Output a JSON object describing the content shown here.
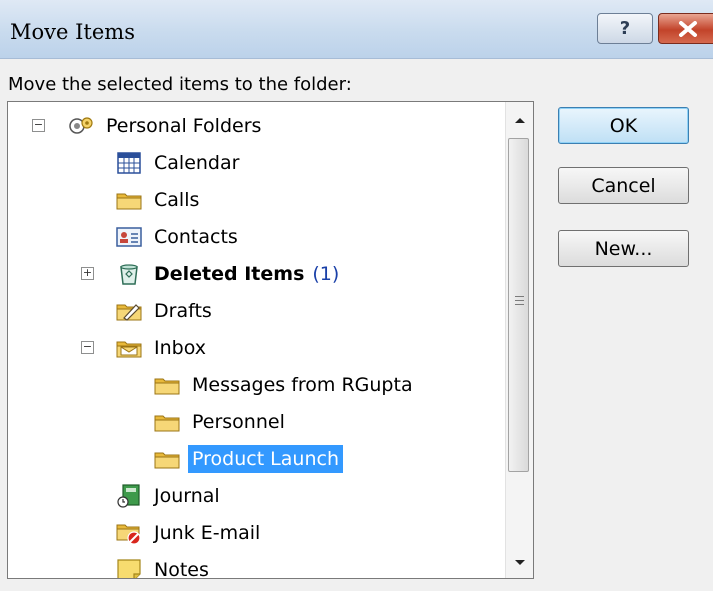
{
  "window": {
    "title": "Move Items",
    "help_label": "?"
  },
  "instruction": "Move the selected items to the folder:",
  "tree": {
    "root": "Personal Folders",
    "items": [
      {
        "label": "Calendar"
      },
      {
        "label": "Calls"
      },
      {
        "label": "Contacts"
      },
      {
        "label": "Deleted Items",
        "count": "(1)"
      },
      {
        "label": "Drafts"
      },
      {
        "label": "Inbox"
      },
      {
        "label": "Messages from RGupta"
      },
      {
        "label": "Personnel"
      },
      {
        "label": "Product Launch",
        "selected": true
      },
      {
        "label": "Journal"
      },
      {
        "label": "Junk E-mail"
      },
      {
        "label": "Notes"
      }
    ]
  },
  "buttons": {
    "ok": "OK",
    "cancel": "Cancel",
    "new": "New..."
  },
  "colors": {
    "selection": "#3399ff",
    "count": "#1a40a8",
    "default_button": "#bfe0f5"
  }
}
